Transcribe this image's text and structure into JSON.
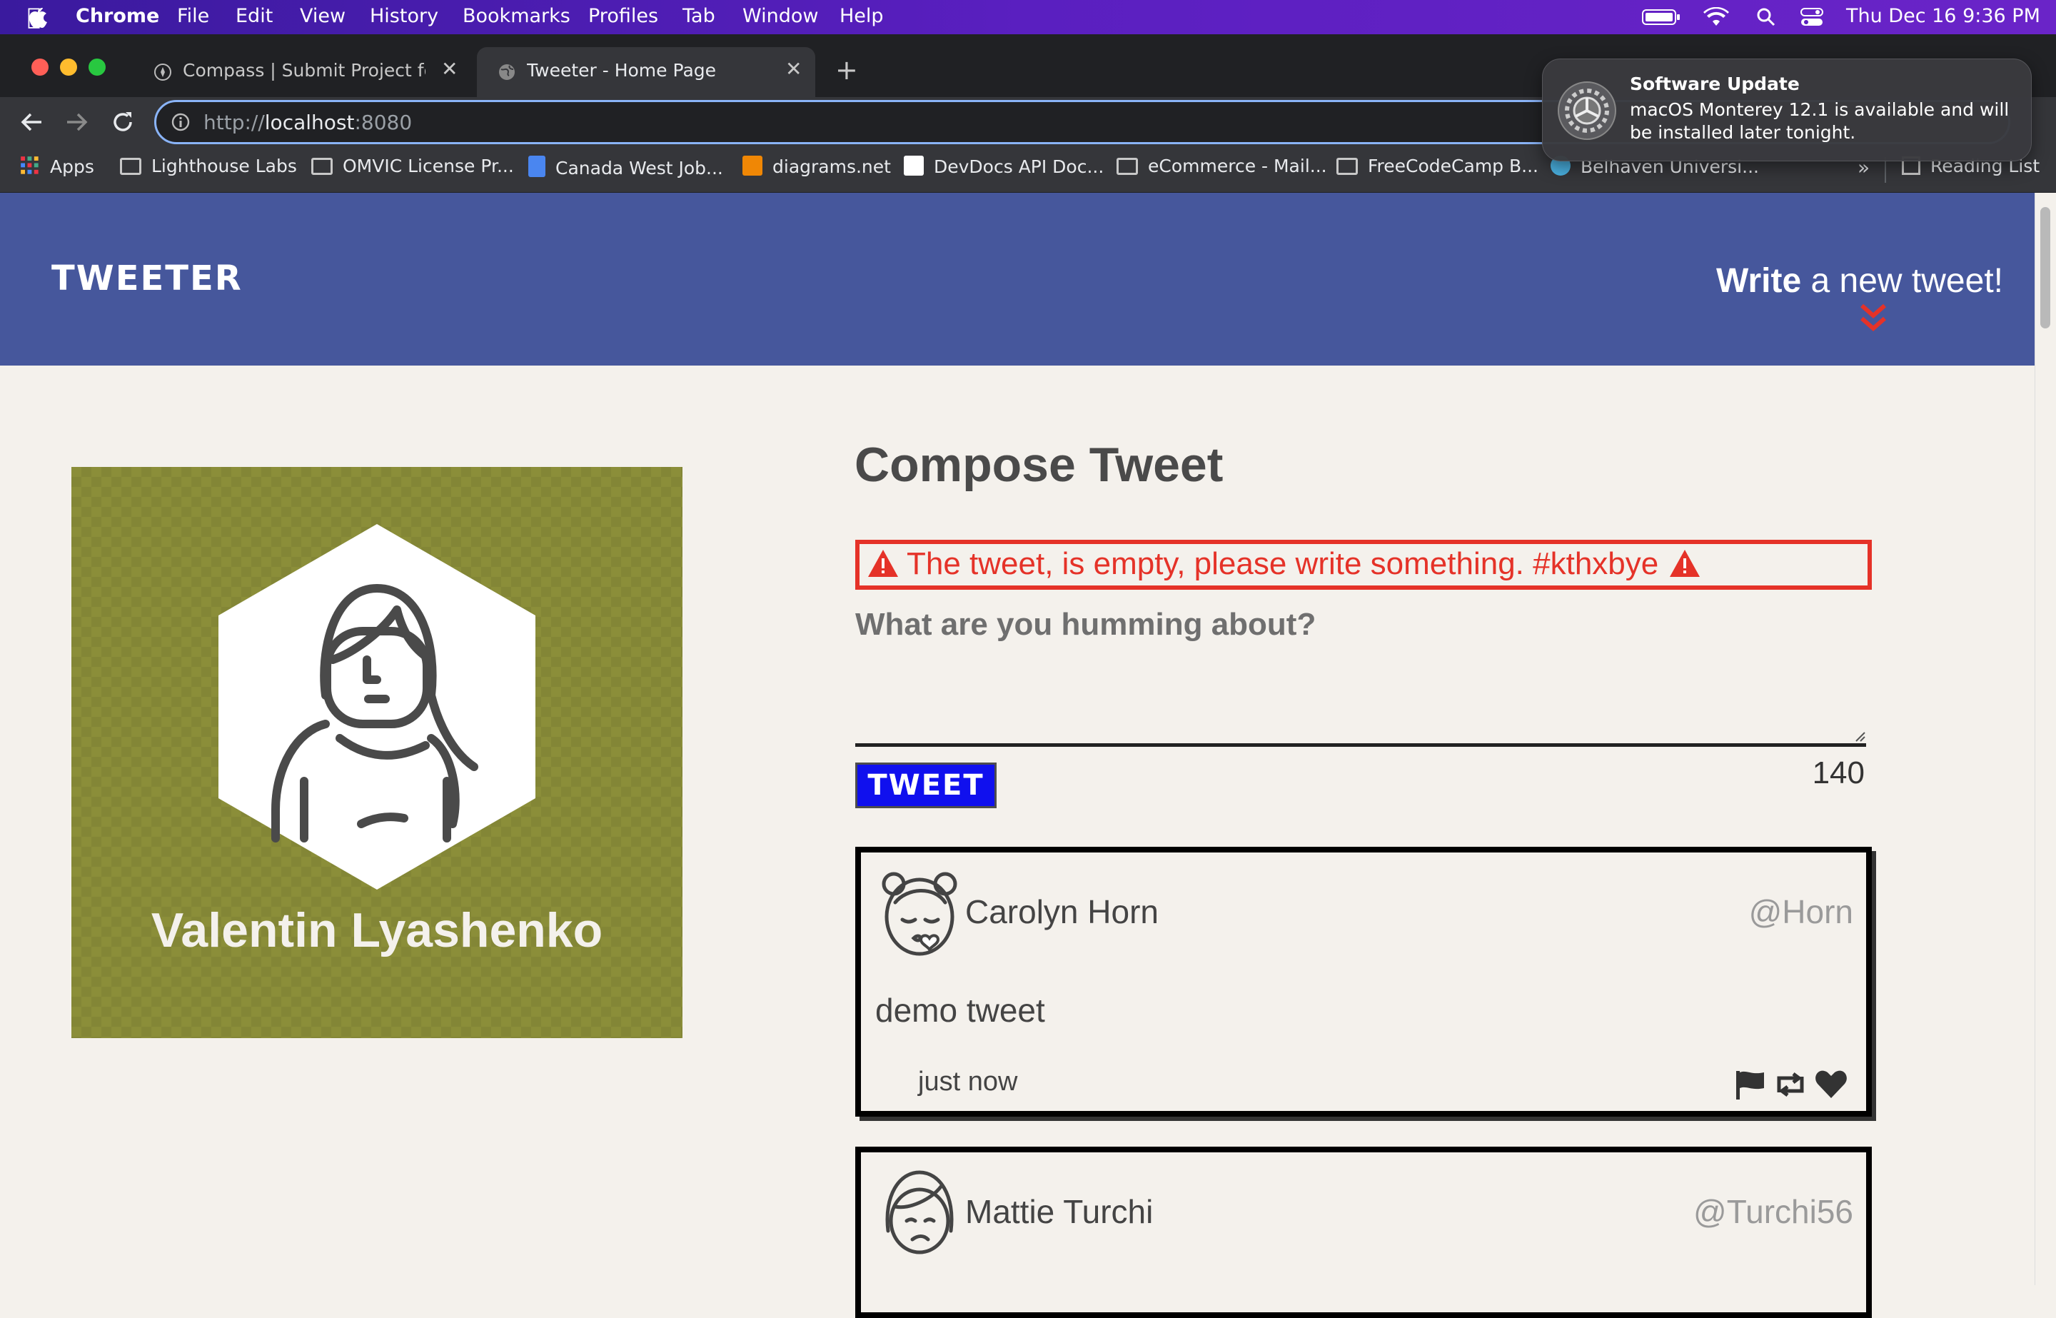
{
  "menubar": {
    "app": "Chrome",
    "items": [
      "File",
      "Edit",
      "View",
      "History",
      "Bookmarks",
      "Profiles",
      "Tab",
      "Window",
      "Help"
    ],
    "clock": "Thu Dec 16  9:36 PM"
  },
  "tabs": [
    {
      "label": "Compass | Submit Project for E",
      "active": false
    },
    {
      "label": "Tweeter - Home Page",
      "active": true
    }
  ],
  "address": {
    "scheme": "http://",
    "host": "localhost",
    "port": ":8080"
  },
  "bookmarks": [
    "Apps",
    "Lighthouse Labs",
    "OMVIC License Pr...",
    "Canada West Job...",
    "diagrams.net",
    "DevDocs API Doc...",
    "eCommerce - Mail...",
    "FreeCodeCamp B...",
    "Belhaven Universi..."
  ],
  "bookmarks_more": "»",
  "reading_list": "Reading List",
  "notification": {
    "title": "Software Update",
    "body_line1": "macOS Monterey 12.1 is available and will",
    "body_line2": "be installed later tonight."
  },
  "nav": {
    "brand": "TWEETER",
    "write_bold": "Write",
    "write_rest": " a new tweet!"
  },
  "profile": {
    "name": "Valentin Lyashenko"
  },
  "compose": {
    "title": "Compose Tweet",
    "error": "The tweet, is empty, please write something. #kthxbye",
    "placeholder": "What are you humming about?",
    "button": "TWEET",
    "counter": "140"
  },
  "tweets": [
    {
      "name": "Carolyn Horn",
      "handle": "@Horn",
      "text": "demo tweet",
      "time": "just now"
    },
    {
      "name": "Mattie Turchi",
      "handle": "@Turchi56",
      "text": "",
      "time": ""
    }
  ],
  "colors": {
    "navbar": "#46579c",
    "error": "#e53228",
    "tweet_button": "#1010ee",
    "profile_bg": "#8b8e39",
    "page_bg": "#f4f1ec"
  }
}
